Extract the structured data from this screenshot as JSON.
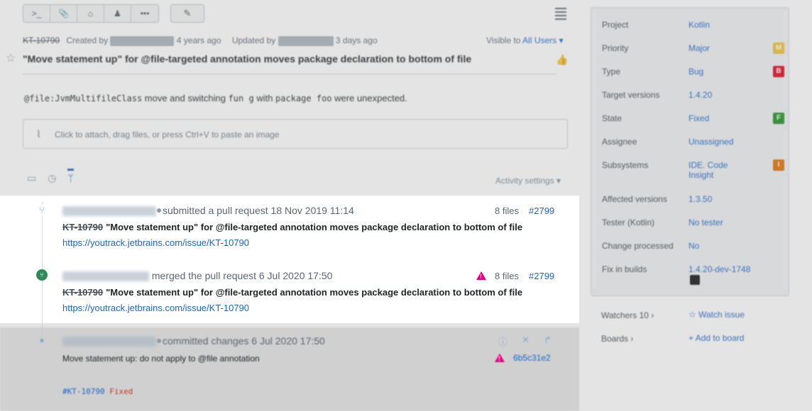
{
  "toolbar": {
    "buttons": [
      {
        "name": "command-icon",
        "glyph": ">_"
      },
      {
        "name": "attachment-icon",
        "glyph": "📎"
      },
      {
        "name": "tag-icon",
        "glyph": "⌂"
      },
      {
        "name": "user-icon",
        "glyph": "♟"
      },
      {
        "name": "more-icon",
        "glyph": "•••"
      }
    ],
    "edit_glyph": "✎"
  },
  "issue": {
    "id": "KT-10790",
    "created_label": "Created by",
    "created_ago": "4 years ago",
    "updated_label": "Updated by",
    "updated_ago": "3 days ago",
    "visible_label": "Visible to",
    "visible_value": "All Users ▾",
    "title": "\"Move statement up\" for @file-targeted annotation moves package declaration to bottom of file",
    "description_parts": [
      "@file:JvmMultifileClass",
      " move and switching ",
      "fun g",
      " with ",
      "package foo",
      " were unexpected."
    ],
    "attach_placeholder": "Click to attach, drag files, or press Ctrl+V to paste an image",
    "activity_settings": "Activity settings ▾"
  },
  "sidebar": {
    "fields": [
      {
        "label": "Project",
        "value": "Kotlin"
      },
      {
        "label": "Priority",
        "value": "Major",
        "badge": "M",
        "color": "#f0c030"
      },
      {
        "label": "Type",
        "value": "Bug",
        "badge": "B",
        "color": "#e0001a"
      },
      {
        "label": "Target versions",
        "value": "1.4.20"
      },
      {
        "label": "State",
        "value": "Fixed",
        "badge": "F",
        "color": "#1b8f1b"
      },
      {
        "label": "Assignee",
        "value": "Unassigned"
      },
      {
        "label": "Subsystems",
        "value": "IDE. Code Insight",
        "badge": "I",
        "color": "#e06c00"
      },
      {
        "label": "Affected versions",
        "value": "1.3.50"
      },
      {
        "label": "Tester (Kotlin)",
        "value": "No tester"
      },
      {
        "label": "Change processed",
        "value": "No"
      },
      {
        "label": "Fix in builds",
        "value": "1.4.20-dev-1748"
      }
    ],
    "watchers": "Watchers 10 ›",
    "watch_issue": "Watch issue",
    "boards": "Boards ›",
    "add_to_board": "Add to board"
  },
  "activity": [
    {
      "action": "submitted a pull request 18 Nov 2019 11:14",
      "files": "8 files",
      "pr": "#2799",
      "id": "KT-10790",
      "title": "\"Move statement up\" for @file-targeted annotation moves package declaration to bottom of file",
      "link": "https://youtrack.jetbrains.com/issue/KT-10790"
    },
    {
      "action": "merged the pull request 6 Jul 2020 17:50",
      "files": "8 files",
      "pr": "#2799",
      "id": "KT-10790",
      "title": "\"Move statement up\" for @file-targeted annotation moves package declaration to bottom of file",
      "link": "https://youtrack.jetbrains.com/issue/KT-10790"
    },
    {
      "action": "committed changes 6 Jul 2020 17:50",
      "message": "Move statement up: do not apply to @file annotation",
      "hash": "6b5c31e2",
      "footer_id": "#KT-10790",
      "footer_state": "Fixed"
    }
  ],
  "colors": {
    "link": "#1a64c8",
    "warning": "#e6007e",
    "merge": "#2e8b57"
  }
}
